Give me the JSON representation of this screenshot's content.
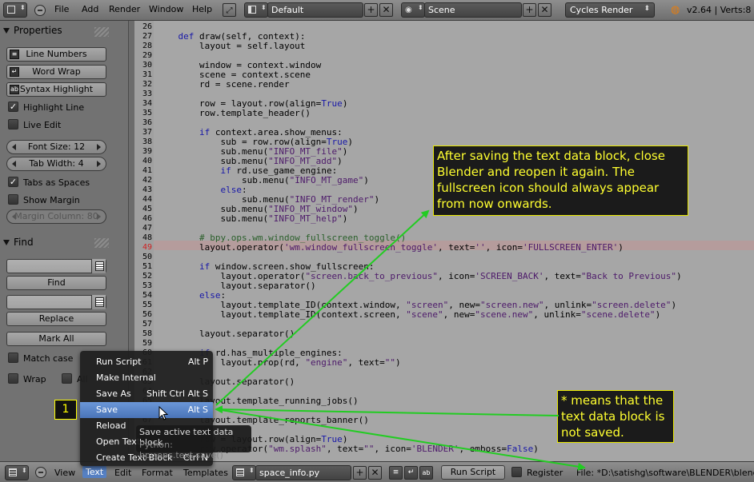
{
  "topbar": {
    "menus": [
      "File",
      "Add",
      "Render",
      "Window",
      "Help"
    ],
    "screen_layout": "Default",
    "scene": "Scene",
    "render_engine": "Cycles Render",
    "version_info": "v2.64 | Verts:8 |"
  },
  "properties": {
    "header": "Properties",
    "buttons": [
      "Line Numbers",
      "Word Wrap",
      "Syntax Highlight"
    ],
    "highlight_line": "Highlight Line",
    "live_edit": "Live Edit",
    "font_size": "Font Size: 12",
    "tab_width": "Tab Width: 4",
    "tabs_as_spaces": "Tabs as Spaces",
    "show_margin": "Show Margin",
    "margin_column": "Margin Column: 80"
  },
  "find": {
    "header": "Find",
    "find_button": "Find",
    "replace_button": "Replace",
    "mark_all_button": "Mark All",
    "match_case": "Match case",
    "wrap": "Wrap",
    "all": "All"
  },
  "code_lines": [
    {
      "n": "26",
      "t": ""
    },
    {
      "n": "27",
      "t": "    def draw(self, context):"
    },
    {
      "n": "28",
      "t": "        layout = self.layout"
    },
    {
      "n": "29",
      "t": ""
    },
    {
      "n": "30",
      "t": "        window = context.window"
    },
    {
      "n": "31",
      "t": "        scene = context.scene"
    },
    {
      "n": "32",
      "t": "        rd = scene.render"
    },
    {
      "n": "33",
      "t": ""
    },
    {
      "n": "34",
      "t": "        row = layout.row(align=True)"
    },
    {
      "n": "35",
      "t": "        row.template_header()"
    },
    {
      "n": "36",
      "t": ""
    },
    {
      "n": "37",
      "t": "        if context.area.show_menus:"
    },
    {
      "n": "38",
      "t": "            sub = row.row(align=True)"
    },
    {
      "n": "39",
      "t": "            sub.menu(\"INFO_MT_file\")"
    },
    {
      "n": "40",
      "t": "            sub.menu(\"INFO_MT_add\")"
    },
    {
      "n": "41",
      "t": "            if rd.use_game_engine:"
    },
    {
      "n": "42",
      "t": "                sub.menu(\"INFO_MT_game\")"
    },
    {
      "n": "43",
      "t": "            else:"
    },
    {
      "n": "44",
      "t": "                sub.menu(\"INFO_MT_render\")"
    },
    {
      "n": "45",
      "t": "            sub.menu(\"INFO_MT_window\")"
    },
    {
      "n": "46",
      "t": "            sub.menu(\"INFO_MT_help\")"
    },
    {
      "n": "47",
      "t": ""
    },
    {
      "n": "48",
      "t": "        # bpy.ops.wm.window_fullscreen_toggle()"
    },
    {
      "n": "49",
      "t": "        layout.operator('wm.window_fullscreen_toggle', text='', icon='FULLSCREEN_ENTER')"
    },
    {
      "n": "50",
      "t": ""
    },
    {
      "n": "51",
      "t": "        if window.screen.show_fullscreen:"
    },
    {
      "n": "52",
      "t": "            layout.operator(\"screen.back_to_previous\", icon='SCREEN_BACK', text=\"Back to Previous\")"
    },
    {
      "n": "53",
      "t": "            layout.separator()"
    },
    {
      "n": "54",
      "t": "        else:"
    },
    {
      "n": "55",
      "t": "            layout.template_ID(context.window, \"screen\", new=\"screen.new\", unlink=\"screen.delete\")"
    },
    {
      "n": "56",
      "t": "            layout.template_ID(context.screen, \"scene\", new=\"scene.new\", unlink=\"scene.delete\")"
    },
    {
      "n": "57",
      "t": ""
    },
    {
      "n": "58",
      "t": "        layout.separator()"
    },
    {
      "n": "59",
      "t": ""
    },
    {
      "n": "60",
      "t": "        if rd.has_multiple_engines:"
    },
    {
      "n": "61",
      "t": "            layout.prop(rd, \"engine\", text=\"\")"
    },
    {
      "n": "62",
      "t": ""
    },
    {
      "n": "63",
      "t": "        layout.separator()"
    },
    {
      "n": "64",
      "t": ""
    },
    {
      "n": "65",
      "t": "        layout.template_running_jobs()"
    },
    {
      "n": "66",
      "t": ""
    },
    {
      "n": "67",
      "t": "        layout.template_reports_banner()"
    },
    {
      "n": "68",
      "t": ""
    },
    {
      "n": "69",
      "t": "        row = layout.row(align=True)"
    },
    {
      "n": "70",
      "t": "        row.operator(\"wm.splash\", text=\"\", icon='BLENDER', emboss=False)"
    }
  ],
  "popup_menu": [
    {
      "label": "Run Script",
      "shortcut": "Alt P"
    },
    {
      "label": "Make Internal",
      "shortcut": ""
    },
    {
      "label": "Save As",
      "shortcut": "Shift Ctrl Alt S"
    },
    {
      "label": "Save",
      "shortcut": "Alt S"
    },
    {
      "label": "Reload",
      "shortcut": ""
    },
    {
      "label": "Open Text",
      "shortcut": ""
    },
    {
      "label": "Create Text Block",
      "shortcut": "Ctrl N"
    }
  ],
  "tooltip": {
    "line1": "Save active text data block",
    "line2": "Python: bpy.ops.text.save()"
  },
  "bottombar": {
    "menus": [
      "View",
      "Text",
      "Edit",
      "Format",
      "Templates"
    ],
    "text_name": "space_info.py",
    "run_script": "Run Script",
    "register": "Register",
    "file_path": "File: *D:\\satishg\\software\\BLENDER\\blend"
  },
  "annotations": {
    "step_number": "1",
    "note_fullscreen": "After saving the text data block, close Blender and reopen it again. The fullscreen icon should always appear from now onwards.",
    "note_asterisk": "* means that the text data block is not saved."
  },
  "colors": {
    "editor_bg": "#a6a6a6",
    "menu_selected": "#5680c2",
    "callout_text": "#ffff30",
    "arrow": "#22cc22"
  }
}
